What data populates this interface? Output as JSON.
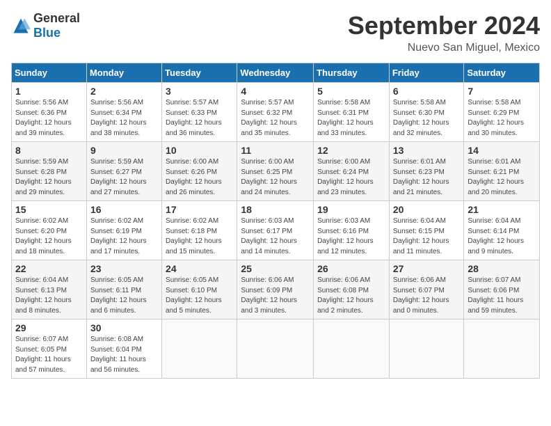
{
  "header": {
    "logo": {
      "general": "General",
      "blue": "Blue"
    },
    "title": "September 2024",
    "location": "Nuevo San Miguel, Mexico"
  },
  "columns": [
    "Sunday",
    "Monday",
    "Tuesday",
    "Wednesday",
    "Thursday",
    "Friday",
    "Saturday"
  ],
  "weeks": [
    [
      {
        "day": "1",
        "info": "Sunrise: 5:56 AM\nSunset: 6:36 PM\nDaylight: 12 hours\nand 39 minutes."
      },
      {
        "day": "2",
        "info": "Sunrise: 5:56 AM\nSunset: 6:34 PM\nDaylight: 12 hours\nand 38 minutes."
      },
      {
        "day": "3",
        "info": "Sunrise: 5:57 AM\nSunset: 6:33 PM\nDaylight: 12 hours\nand 36 minutes."
      },
      {
        "day": "4",
        "info": "Sunrise: 5:57 AM\nSunset: 6:32 PM\nDaylight: 12 hours\nand 35 minutes."
      },
      {
        "day": "5",
        "info": "Sunrise: 5:58 AM\nSunset: 6:31 PM\nDaylight: 12 hours\nand 33 minutes."
      },
      {
        "day": "6",
        "info": "Sunrise: 5:58 AM\nSunset: 6:30 PM\nDaylight: 12 hours\nand 32 minutes."
      },
      {
        "day": "7",
        "info": "Sunrise: 5:58 AM\nSunset: 6:29 PM\nDaylight: 12 hours\nand 30 minutes."
      }
    ],
    [
      {
        "day": "8",
        "info": "Sunrise: 5:59 AM\nSunset: 6:28 PM\nDaylight: 12 hours\nand 29 minutes."
      },
      {
        "day": "9",
        "info": "Sunrise: 5:59 AM\nSunset: 6:27 PM\nDaylight: 12 hours\nand 27 minutes."
      },
      {
        "day": "10",
        "info": "Sunrise: 6:00 AM\nSunset: 6:26 PM\nDaylight: 12 hours\nand 26 minutes."
      },
      {
        "day": "11",
        "info": "Sunrise: 6:00 AM\nSunset: 6:25 PM\nDaylight: 12 hours\nand 24 minutes."
      },
      {
        "day": "12",
        "info": "Sunrise: 6:00 AM\nSunset: 6:24 PM\nDaylight: 12 hours\nand 23 minutes."
      },
      {
        "day": "13",
        "info": "Sunrise: 6:01 AM\nSunset: 6:23 PM\nDaylight: 12 hours\nand 21 minutes."
      },
      {
        "day": "14",
        "info": "Sunrise: 6:01 AM\nSunset: 6:21 PM\nDaylight: 12 hours\nand 20 minutes."
      }
    ],
    [
      {
        "day": "15",
        "info": "Sunrise: 6:02 AM\nSunset: 6:20 PM\nDaylight: 12 hours\nand 18 minutes."
      },
      {
        "day": "16",
        "info": "Sunrise: 6:02 AM\nSunset: 6:19 PM\nDaylight: 12 hours\nand 17 minutes."
      },
      {
        "day": "17",
        "info": "Sunrise: 6:02 AM\nSunset: 6:18 PM\nDaylight: 12 hours\nand 15 minutes."
      },
      {
        "day": "18",
        "info": "Sunrise: 6:03 AM\nSunset: 6:17 PM\nDaylight: 12 hours\nand 14 minutes."
      },
      {
        "day": "19",
        "info": "Sunrise: 6:03 AM\nSunset: 6:16 PM\nDaylight: 12 hours\nand 12 minutes."
      },
      {
        "day": "20",
        "info": "Sunrise: 6:04 AM\nSunset: 6:15 PM\nDaylight: 12 hours\nand 11 minutes."
      },
      {
        "day": "21",
        "info": "Sunrise: 6:04 AM\nSunset: 6:14 PM\nDaylight: 12 hours\nand 9 minutes."
      }
    ],
    [
      {
        "day": "22",
        "info": "Sunrise: 6:04 AM\nSunset: 6:13 PM\nDaylight: 12 hours\nand 8 minutes."
      },
      {
        "day": "23",
        "info": "Sunrise: 6:05 AM\nSunset: 6:11 PM\nDaylight: 12 hours\nand 6 minutes."
      },
      {
        "day": "24",
        "info": "Sunrise: 6:05 AM\nSunset: 6:10 PM\nDaylight: 12 hours\nand 5 minutes."
      },
      {
        "day": "25",
        "info": "Sunrise: 6:06 AM\nSunset: 6:09 PM\nDaylight: 12 hours\nand 3 minutes."
      },
      {
        "day": "26",
        "info": "Sunrise: 6:06 AM\nSunset: 6:08 PM\nDaylight: 12 hours\nand 2 minutes."
      },
      {
        "day": "27",
        "info": "Sunrise: 6:06 AM\nSunset: 6:07 PM\nDaylight: 12 hours\nand 0 minutes."
      },
      {
        "day": "28",
        "info": "Sunrise: 6:07 AM\nSunset: 6:06 PM\nDaylight: 11 hours\nand 59 minutes."
      }
    ],
    [
      {
        "day": "29",
        "info": "Sunrise: 6:07 AM\nSunset: 6:05 PM\nDaylight: 11 hours\nand 57 minutes."
      },
      {
        "day": "30",
        "info": "Sunrise: 6:08 AM\nSunset: 6:04 PM\nDaylight: 11 hours\nand 56 minutes."
      },
      {
        "day": "",
        "info": ""
      },
      {
        "day": "",
        "info": ""
      },
      {
        "day": "",
        "info": ""
      },
      {
        "day": "",
        "info": ""
      },
      {
        "day": "",
        "info": ""
      }
    ]
  ]
}
